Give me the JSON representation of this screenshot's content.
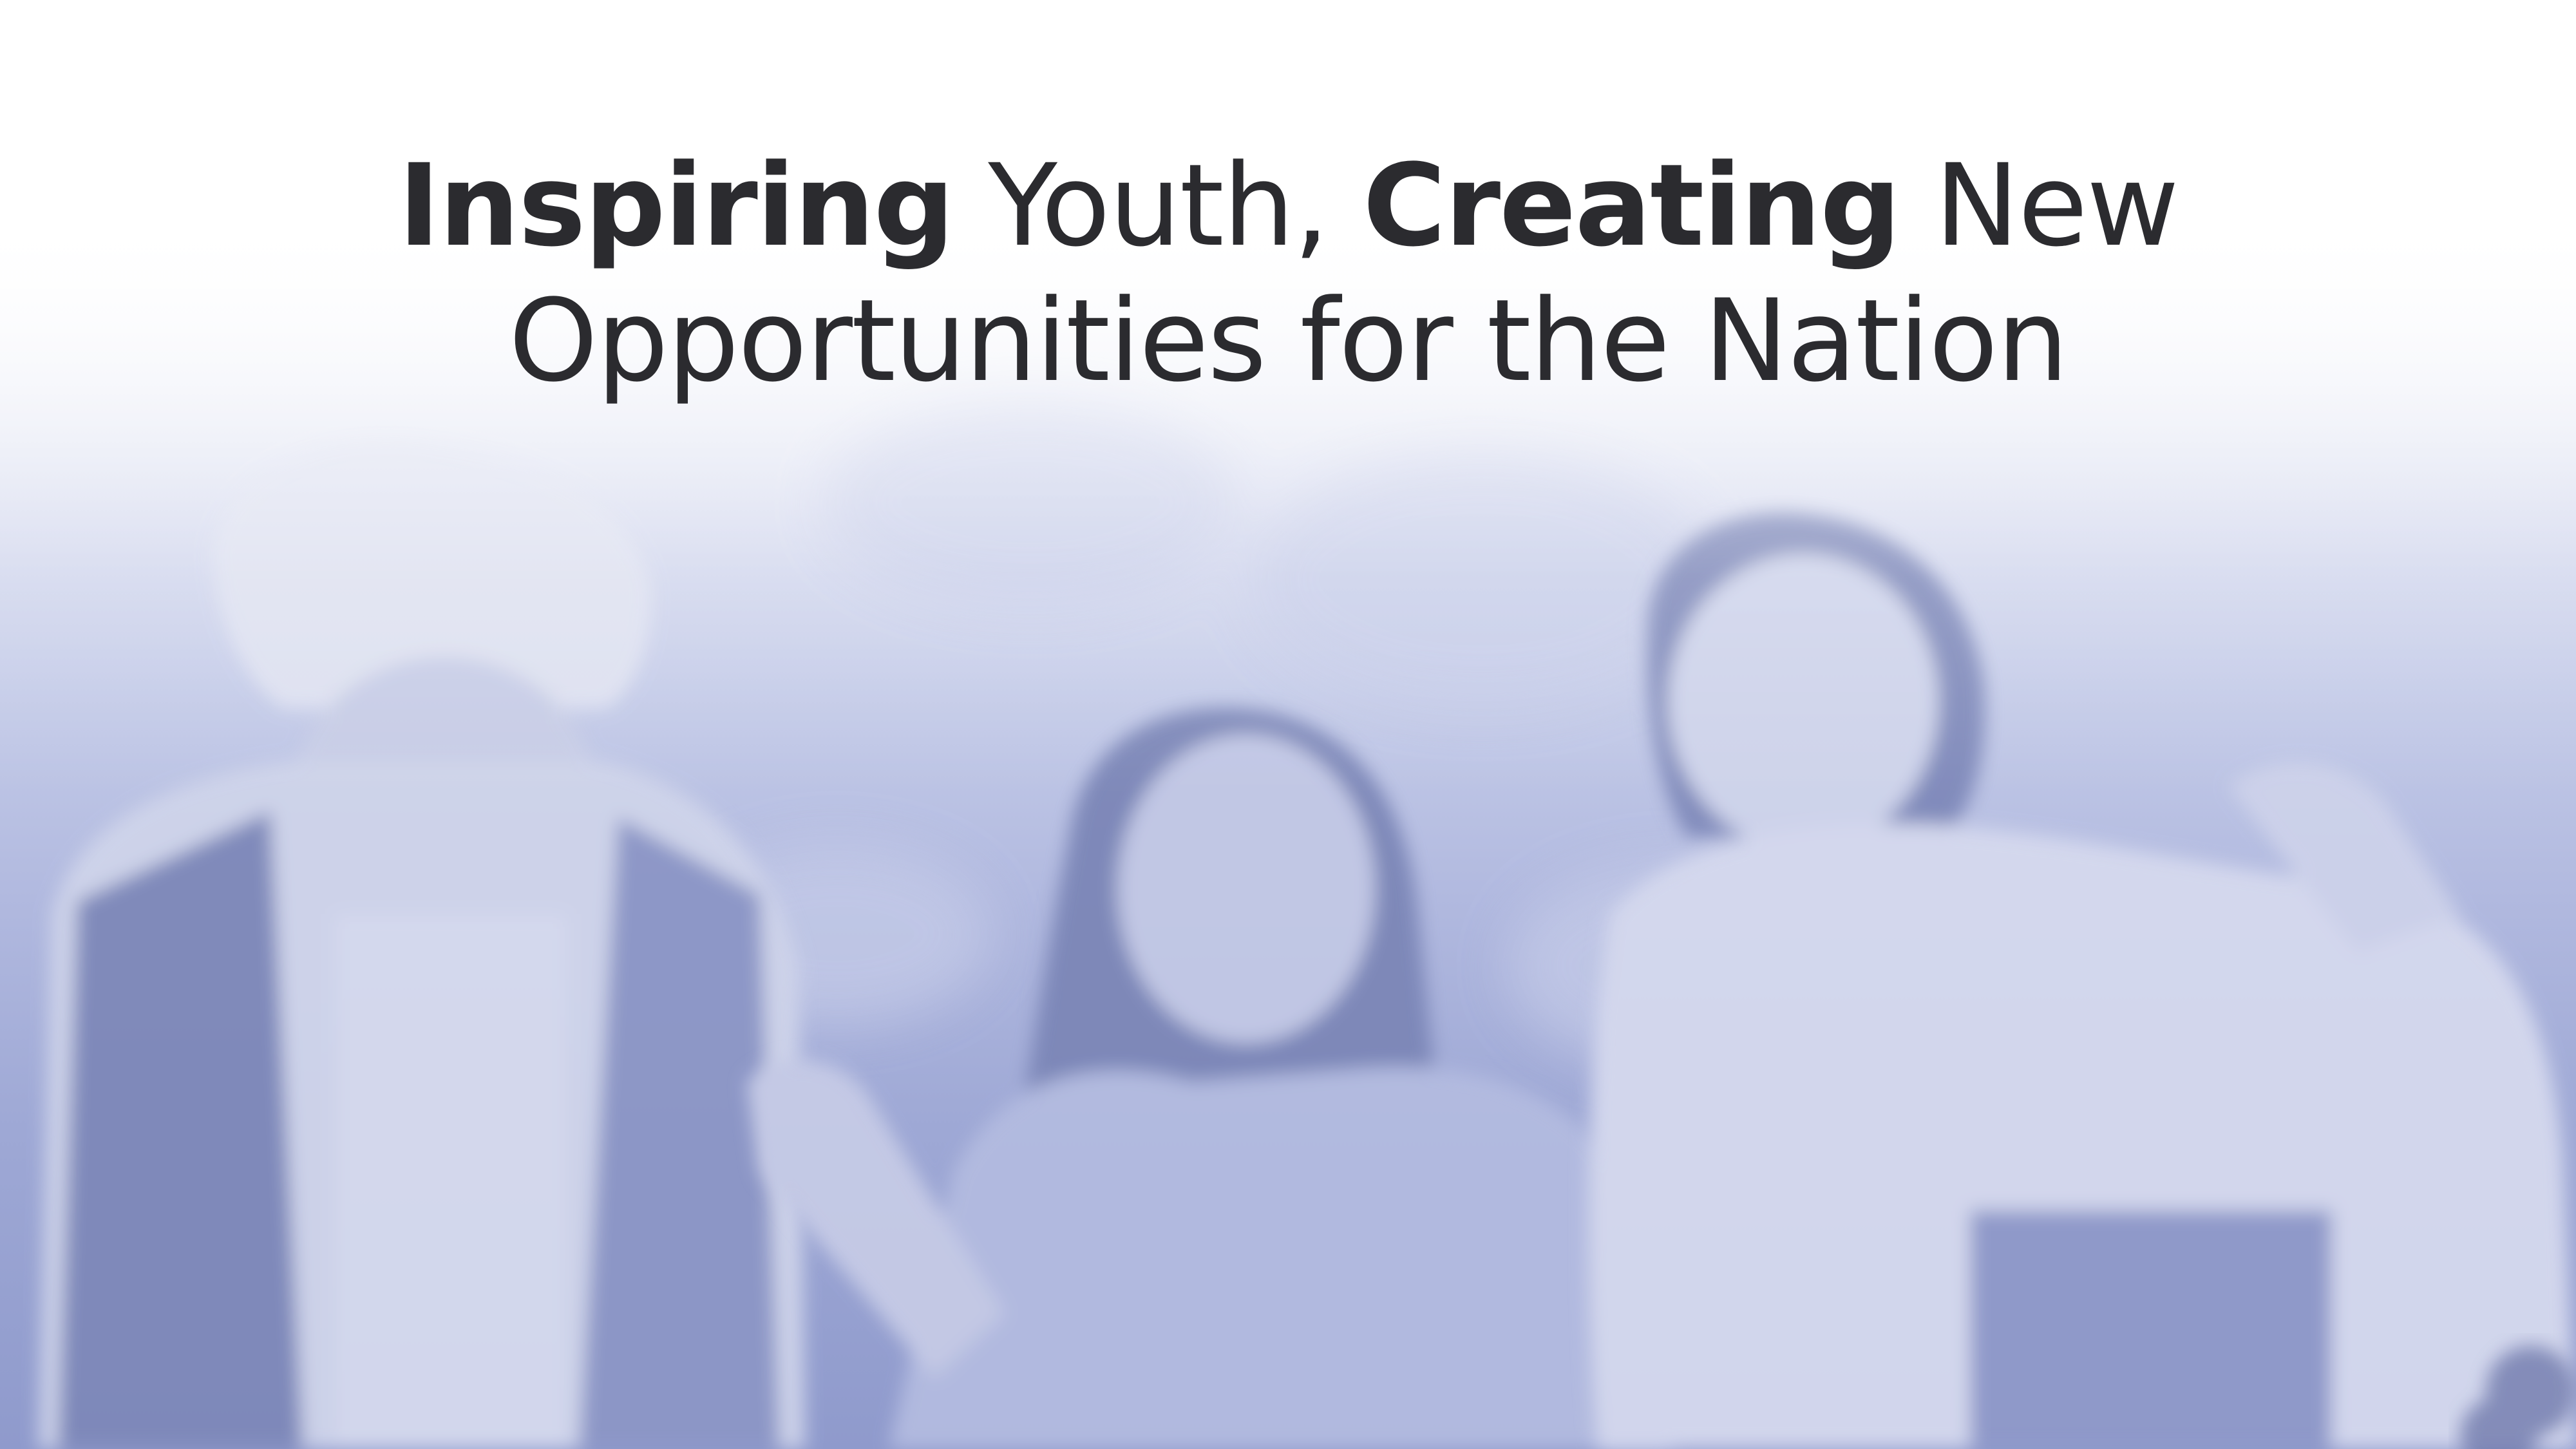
{
  "hero": {
    "headline": {
      "line1_bold_a": "Inspiring",
      "line1_regular_a": " Youth, ",
      "line1_bold_b": "Creating",
      "line1_regular_b": " New",
      "line2": "Opportunities for the Nation"
    },
    "colors": {
      "accent_rule": "#8e9cd0",
      "tint": "#9ea8d5",
      "text": "#2b2b2f"
    }
  }
}
